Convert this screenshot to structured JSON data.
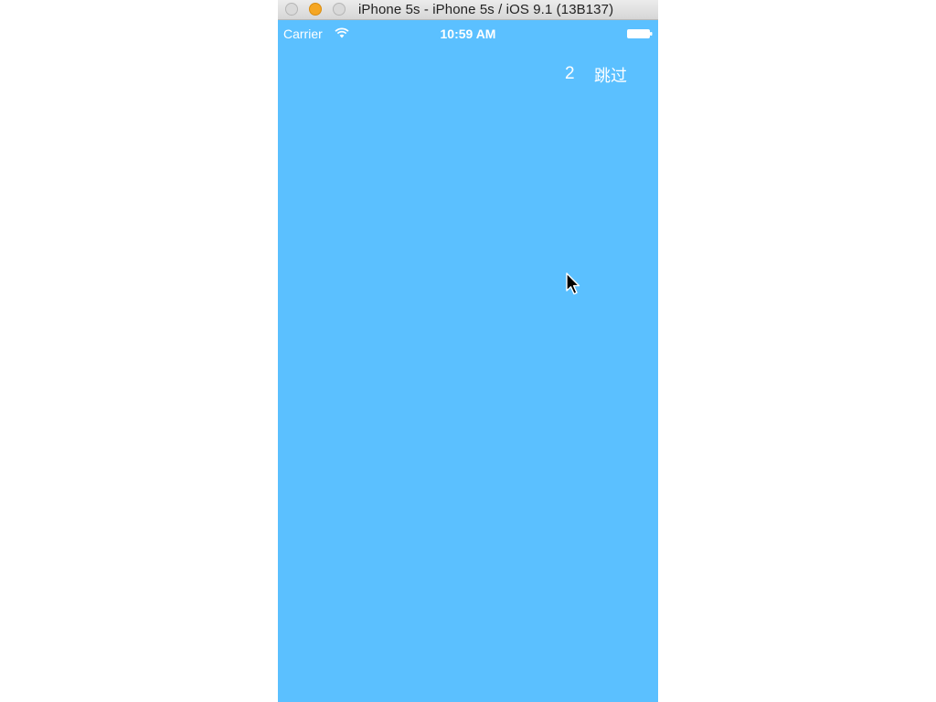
{
  "window": {
    "title": "iPhone 5s - iPhone 5s / iOS 9.1 (13B137)",
    "controls": [
      "close-icon",
      "minimize-icon",
      "zoom-icon"
    ]
  },
  "status_bar": {
    "carrier": "Carrier",
    "time": "10:59 AM",
    "icons": [
      "wifi-icon",
      "battery-icon"
    ]
  },
  "splash": {
    "countdown": "2",
    "skip_label": "跳过",
    "background_color": "#5bc0ff"
  },
  "pointer": {
    "icon": "cursor-icon"
  }
}
